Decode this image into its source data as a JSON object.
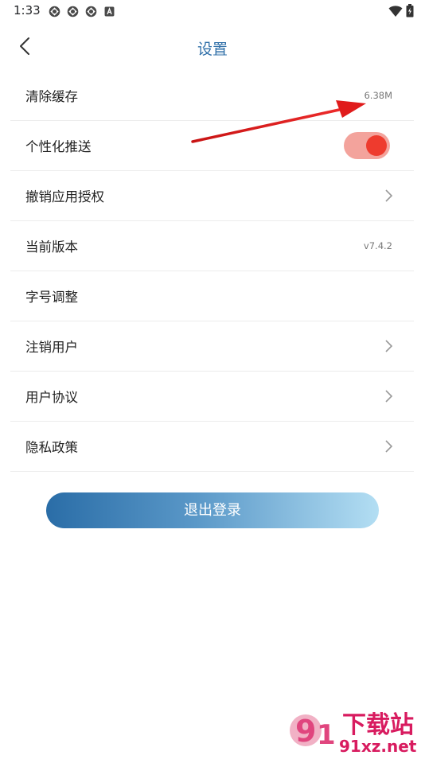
{
  "status_bar": {
    "time": "1:33",
    "notification_icons": [
      "app-notification-icon",
      "app-notification-icon",
      "app-notification-icon",
      "a-badge-icon"
    ],
    "system_icons": [
      "wifi-icon",
      "battery-icon"
    ]
  },
  "header": {
    "title": "设置",
    "back_icon": "chevron-left-icon"
  },
  "settings": {
    "items": [
      {
        "label": "清除缓存",
        "value": "6.38M"
      },
      {
        "label": "个性化推送",
        "toggle_on": true
      },
      {
        "label": "撤销应用授权",
        "icon": "chevron-right-icon"
      },
      {
        "label": "当前版本",
        "value": "v7.4.2"
      },
      {
        "label": "字号调整"
      },
      {
        "label": "注销用户",
        "icon": "chevron-right-icon"
      },
      {
        "label": "用户协议",
        "icon": "chevron-right-icon"
      },
      {
        "label": "隐私政策",
        "icon": "chevron-right-icon"
      }
    ]
  },
  "logout": {
    "label": "退出登录"
  },
  "watermark": {
    "brand": "91下载站",
    "domain": "91xz.net"
  },
  "colors": {
    "title": "#2f6fa8",
    "toggle_track": "#f3a39c",
    "toggle_knob": "#ee3b2e",
    "button_start": "#2a6da7",
    "button_end": "#b3def3",
    "annotation": "#e01b1b"
  }
}
